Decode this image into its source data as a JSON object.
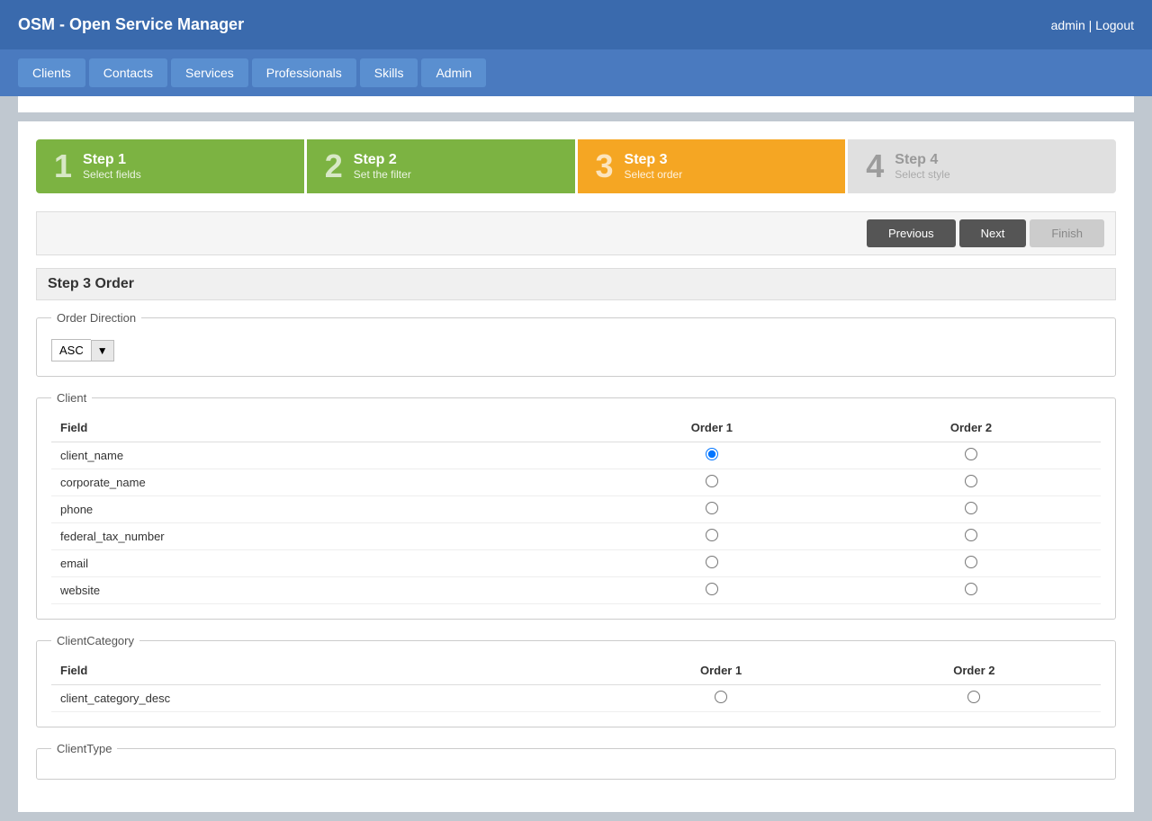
{
  "header": {
    "title": "OSM - Open Service Manager",
    "user_info": "admin | Logout"
  },
  "nav": {
    "items": [
      {
        "label": "Clients",
        "id": "clients"
      },
      {
        "label": "Contacts",
        "id": "contacts"
      },
      {
        "label": "Services",
        "id": "services"
      },
      {
        "label": "Professionals",
        "id": "professionals"
      },
      {
        "label": "Skills",
        "id": "skills"
      },
      {
        "label": "Admin",
        "id": "admin"
      }
    ]
  },
  "steps": [
    {
      "number": "1",
      "title": "Step 1",
      "subtitle": "Select fields",
      "state": "active"
    },
    {
      "number": "2",
      "title": "Step 2",
      "subtitle": "Set the filter",
      "state": "active"
    },
    {
      "number": "3",
      "title": "Step 3",
      "subtitle": "Select order",
      "state": "current"
    },
    {
      "number": "4",
      "title": "Step 4",
      "subtitle": "Select style",
      "state": "inactive"
    }
  ],
  "toolbar": {
    "previous_label": "Previous",
    "next_label": "Next",
    "finish_label": "Finish"
  },
  "section_title": "Step 3 Order",
  "order_direction": {
    "legend": "Order Direction",
    "value": "ASC"
  },
  "client_table": {
    "legend": "Client",
    "col_field": "Field",
    "col_order1": "Order 1",
    "col_order2": "Order 2",
    "rows": [
      {
        "field": "client_name",
        "order1": true,
        "order2": false
      },
      {
        "field": "corporate_name",
        "order1": false,
        "order2": false
      },
      {
        "field": "phone",
        "order1": false,
        "order2": false
      },
      {
        "field": "federal_tax_number",
        "order1": false,
        "order2": false
      },
      {
        "field": "email",
        "order1": false,
        "order2": false
      },
      {
        "field": "website",
        "order1": false,
        "order2": false
      }
    ]
  },
  "client_category_table": {
    "legend": "ClientCategory",
    "col_field": "Field",
    "col_order1": "Order 1",
    "col_order2": "Order 2",
    "rows": [
      {
        "field": "client_category_desc",
        "order1": false,
        "order2": false
      }
    ]
  },
  "client_type_legend": "ClientType"
}
